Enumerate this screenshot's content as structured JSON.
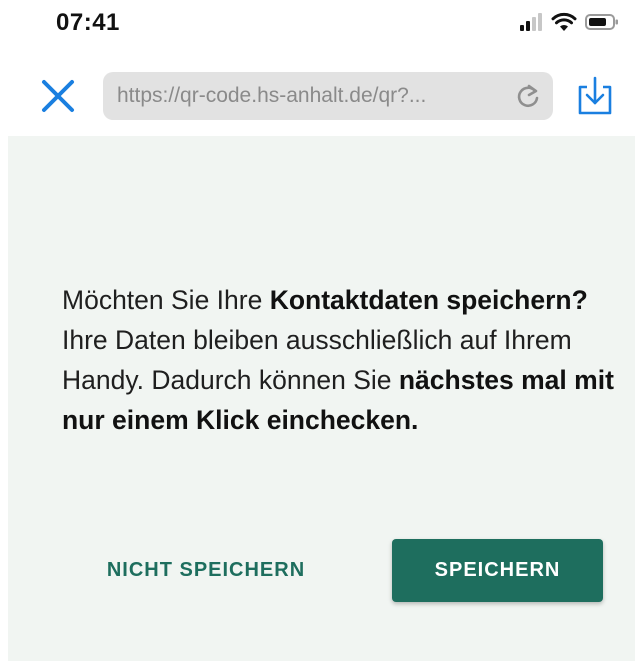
{
  "status_bar": {
    "time": "07:41",
    "icons": [
      "cellular-signal-icon",
      "wifi-icon",
      "battery-icon"
    ]
  },
  "browser": {
    "close_icon": "close-icon",
    "url": "https://qr-code.hs-anhalt.de/qr?...",
    "reload_icon": "reload-icon",
    "download_icon": "download-icon",
    "accent_color": "#1a7fe0"
  },
  "dialog": {
    "message_parts": [
      {
        "text": "Möchten Sie Ihre ",
        "bold": false
      },
      {
        "text": "Kontaktdaten speichern?",
        "bold": true
      },
      {
        "text": " Ihre Daten bleiben ausschließlich auf Ihrem Handy. Dadurch können Sie ",
        "bold": false
      },
      {
        "text": "nächstes mal mit nur einem Klick einchecken.",
        "bold": true
      }
    ],
    "skip_label": "NICHT SPEICHERN",
    "save_label": "SPEICHERN",
    "background_color": "#f1f5f2",
    "primary_color": "#1e6e5e"
  }
}
